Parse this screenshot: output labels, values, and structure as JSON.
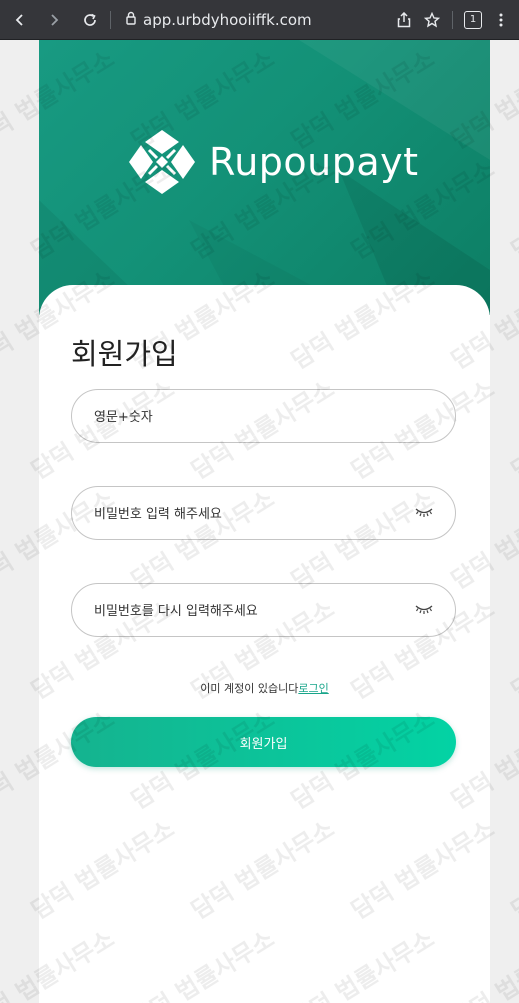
{
  "browser": {
    "url": "app.urbdyhooiiffk.com",
    "tab_count": "1",
    "icons": [
      "back-icon",
      "forward-icon",
      "reload-icon",
      "site-info-icon",
      "share-icon",
      "bookmark-icon",
      "tab-switcher-icon"
    ]
  },
  "brand": {
    "name": "Rupoupayt"
  },
  "form": {
    "title": "회원가입",
    "username_placeholder": "영문+숫자",
    "password_placeholder": "비밀번호 입력 해주세요",
    "confirm_placeholder": "비밀번호를 다시 입력해주세요",
    "have_account_text": "이미 계정이 있습니다",
    "login_link": "로그인",
    "submit_label": "회원가입"
  },
  "watermark": {
    "text": "담덕 법률사무소"
  },
  "colors": {
    "header_green": "#139177",
    "button_start": "#15b38f",
    "button_end": "#03d3a4",
    "link": "#18a58a"
  }
}
